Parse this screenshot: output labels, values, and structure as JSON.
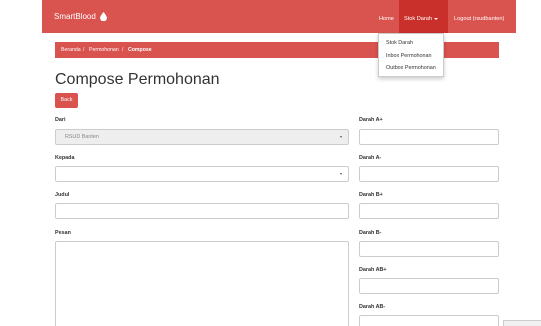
{
  "navbar": {
    "brand": "SmartBlood",
    "home": "Home",
    "stok_darah": "Stok Darah",
    "logout": "Logout (rsudbanten)"
  },
  "dropdown": {
    "items": [
      "Stok Darah",
      "Inbox Permohonan",
      "Outbox Permohonan"
    ]
  },
  "breadcrumb": {
    "items": [
      "Beranda",
      "Permohonan",
      "Compose"
    ],
    "separator": "/"
  },
  "page": {
    "title": "Compose Permohonan",
    "back_label": "Back"
  },
  "form": {
    "dari_label": "Dari",
    "dari_value": "RSUD Banten",
    "kepada_label": "Kepada",
    "kepada_value": "",
    "judul_label": "Judul",
    "pesan_label": "Pesan",
    "darah_a_pos_label": "Darah A+",
    "darah_a_neg_label": "Darah A-",
    "darah_b_pos_label": "Darah B+",
    "darah_b_neg_label": "Darah B-",
    "darah_ab_pos_label": "Darah AB+",
    "darah_ab_neg_label": "Darah AB-"
  },
  "colors": {
    "primary": "#d9534f",
    "primary_dark": "#c9302c"
  },
  "corner_chip": ""
}
